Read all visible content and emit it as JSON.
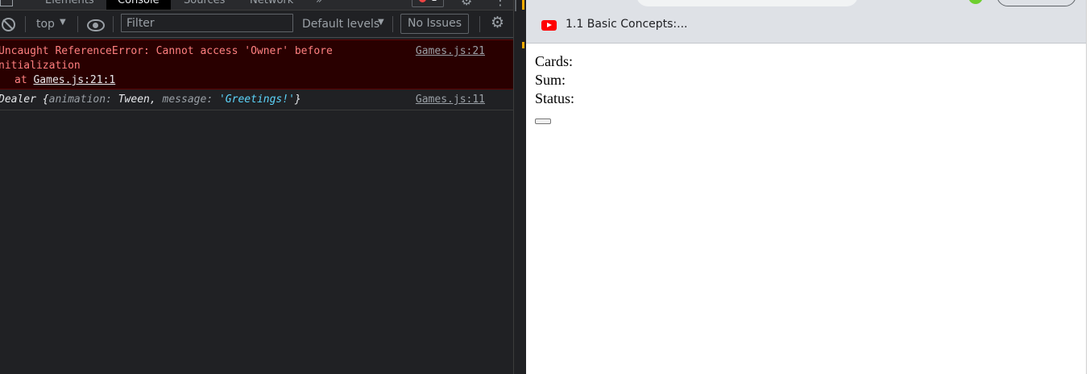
{
  "devtools": {
    "tabs": [
      "Elements",
      "Console",
      "Sources",
      "Network",
      "»"
    ],
    "active_tab": "Console",
    "error_badge_count": "1",
    "toolbar": {
      "context": "top",
      "filter_placeholder": "Filter",
      "levels": "Default levels",
      "issues": "No Issues"
    },
    "console": {
      "error": {
        "line1": "Uncaught ReferenceError: Cannot access 'Owner' before",
        "line2": "nitialization",
        "at_prefix": "at",
        "at_link": "Games.js:21:1",
        "source": "Games.js:21"
      },
      "log": {
        "class_name": "Dealer",
        "brace_open": "{",
        "key1": "animation:",
        "val1": "Tween,",
        "key2": "message:",
        "val2": "'Greetings!'",
        "brace_close": "}",
        "source": "Games.js:11"
      }
    }
  },
  "browser": {
    "bookmark_label": "1.1 Basic Concepts:...",
    "page": {
      "cards_label": "Cards:",
      "sum_label": "Sum:",
      "status_label": "Status:",
      "button_label": ""
    }
  }
}
